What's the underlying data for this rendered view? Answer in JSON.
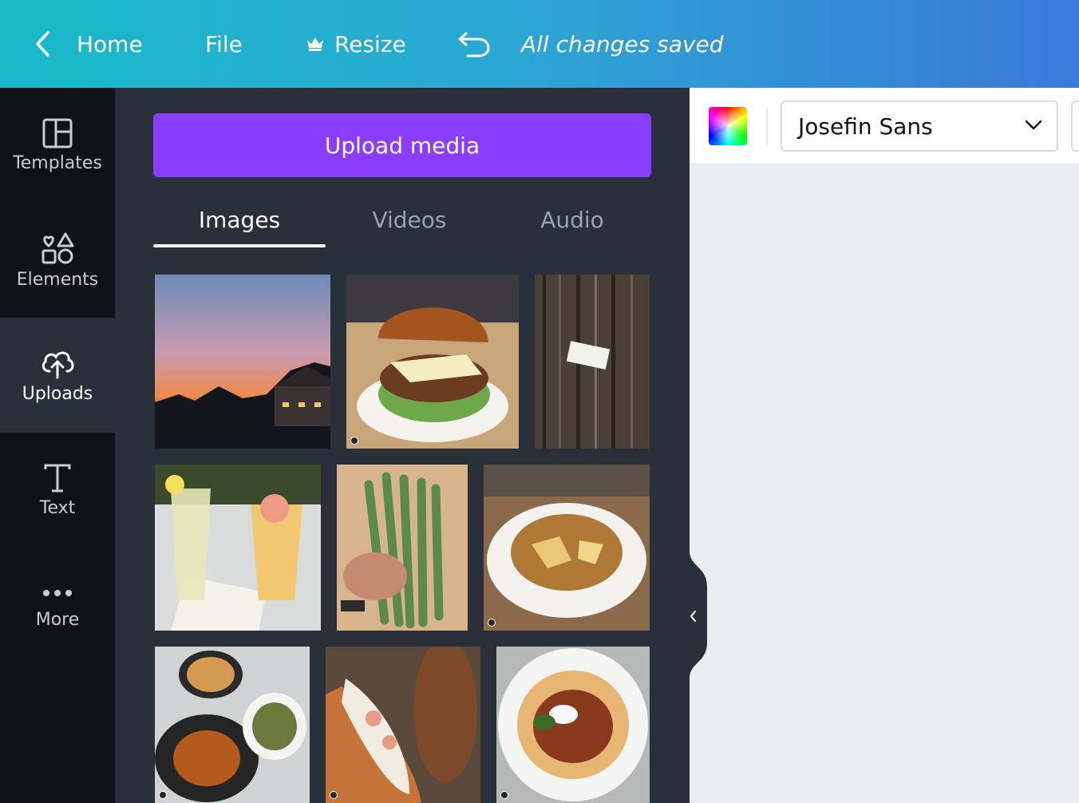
{
  "topbar": {
    "home_label": "Home",
    "file_label": "File",
    "resize_label": "Resize",
    "saved_status": "All changes saved"
  },
  "rail": {
    "items": [
      {
        "label": "Templates",
        "icon": "templates-icon"
      },
      {
        "label": "Elements",
        "icon": "elements-icon"
      },
      {
        "label": "Uploads",
        "icon": "upload-cloud-icon",
        "active": true
      },
      {
        "label": "Text",
        "icon": "text-icon"
      },
      {
        "label": "More",
        "icon": "more-dots-icon"
      }
    ]
  },
  "panel": {
    "upload_button": "Upload media",
    "tabs": [
      {
        "label": "Images",
        "active": true
      },
      {
        "label": "Videos"
      },
      {
        "label": "Audio"
      }
    ],
    "images": [
      {
        "subject": "sunset over lake house"
      },
      {
        "subject": "pulled pork sandwich"
      },
      {
        "subject": "weathered wood door sign"
      },
      {
        "subject": "cocktails with menu"
      },
      {
        "subject": "bunch of asparagus"
      },
      {
        "subject": "pasta bowl with cheese"
      },
      {
        "subject": "roast chicken spread"
      },
      {
        "subject": "lobster roll with chips"
      },
      {
        "subject": "pappardelle bolognese"
      }
    ]
  },
  "toolbar": {
    "font_name": "Josefin Sans"
  },
  "colors": {
    "accent": "#8b3dff",
    "panel_bg": "#293039",
    "rail_bg": "#0e1318"
  }
}
